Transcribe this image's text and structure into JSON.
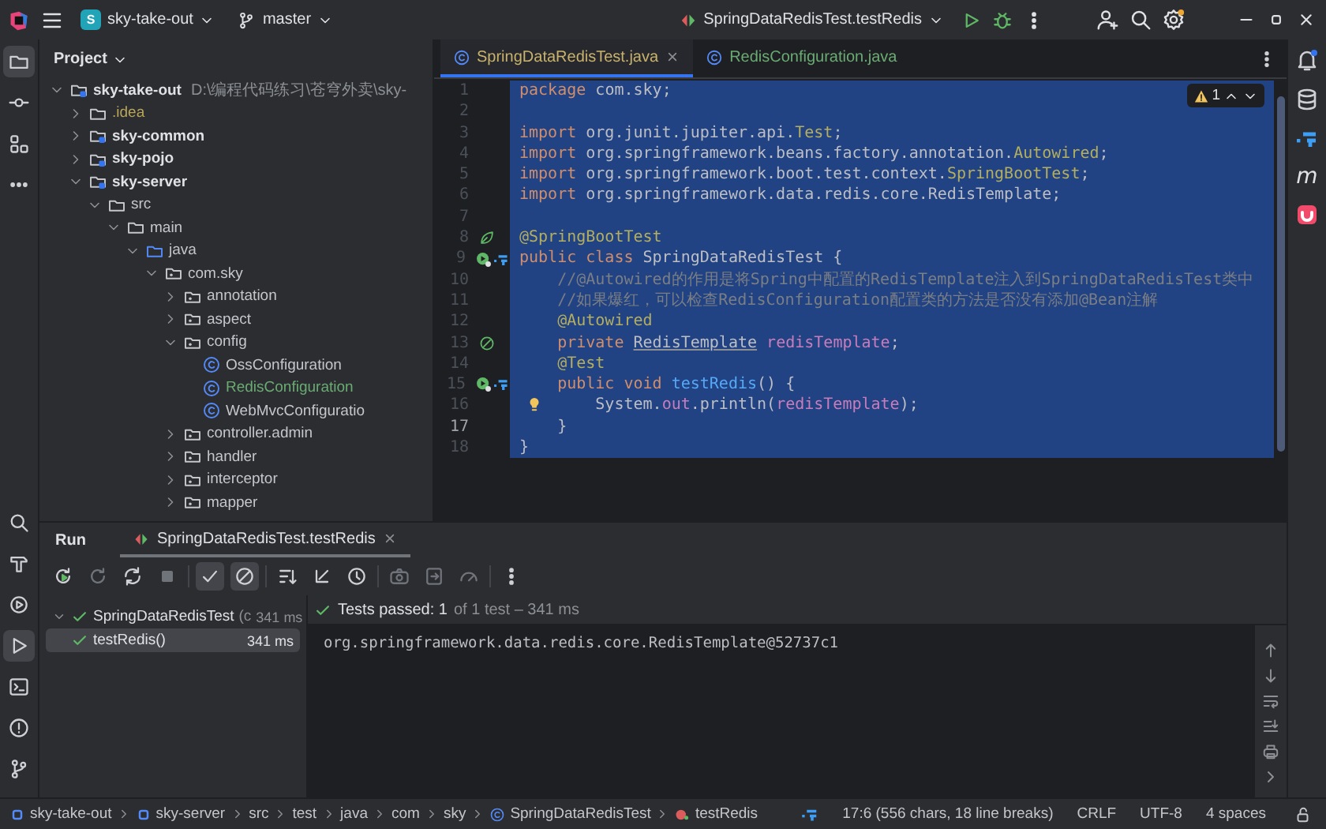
{
  "title_bar": {
    "project": {
      "badge": "S",
      "name": "sky-take-out"
    },
    "branch": "master",
    "run_configuration": "SpringDataRedisTest.testRedis"
  },
  "left_toolbar": {
    "top": [
      {
        "kind": "project",
        "selected": true
      },
      {
        "kind": "commit",
        "selected": false
      },
      {
        "kind": "structure",
        "selected": false
      },
      {
        "kind": "more",
        "selected": false
      }
    ],
    "bottom": [
      {
        "kind": "search",
        "selected": false
      },
      {
        "kind": "build",
        "selected": false
      },
      {
        "kind": "services",
        "selected": false
      },
      {
        "kind": "run",
        "selected": true
      },
      {
        "kind": "terminal",
        "selected": false
      },
      {
        "kind": "problems",
        "selected": false
      },
      {
        "kind": "git",
        "selected": false
      }
    ]
  },
  "right_toolbar": [
    {
      "kind": "notifications"
    },
    {
      "kind": "database"
    },
    {
      "kind": "plugin"
    },
    {
      "kind": "maven",
      "glyph": "m"
    },
    {
      "kind": "app"
    }
  ],
  "project_panel": {
    "title": "Project",
    "tree": [
      {
        "name": "sky-take-out",
        "kind": "module",
        "hint": "D:\\编程代码练习\\苍穹外卖\\sky-",
        "expanded": true,
        "children": [
          {
            "name": ".idea",
            "kind": "folder",
            "color": "#b8a75a",
            "expanded": false
          },
          {
            "name": "sky-common",
            "kind": "module",
            "expanded": false
          },
          {
            "name": "sky-pojo",
            "kind": "module",
            "expanded": false
          },
          {
            "name": "sky-server",
            "kind": "module",
            "expanded": true,
            "children": [
              {
                "name": "src",
                "kind": "folder",
                "expanded": true,
                "children": [
                  {
                    "name": "main",
                    "kind": "folder",
                    "expanded": true,
                    "children": [
                      {
                        "name": "java",
                        "kind": "source",
                        "expanded": true,
                        "children": [
                          {
                            "name": "com.sky",
                            "kind": "package",
                            "expanded": true,
                            "children": [
                              {
                                "name": "annotation",
                                "kind": "package",
                                "expanded": false
                              },
                              {
                                "name": "aspect",
                                "kind": "package",
                                "expanded": false
                              },
                              {
                                "name": "config",
                                "kind": "package",
                                "expanded": true,
                                "children": [
                                  {
                                    "name": "OssConfiguration",
                                    "kind": "class"
                                  },
                                  {
                                    "name": "RedisConfiguration",
                                    "kind": "class",
                                    "color": "#6aab73"
                                  },
                                  {
                                    "name": "WebMvcConfiguratio",
                                    "kind": "class"
                                  }
                                ]
                              },
                              {
                                "name": "controller.admin",
                                "kind": "package",
                                "expanded": false
                              },
                              {
                                "name": "handler",
                                "kind": "package",
                                "expanded": false
                              },
                              {
                                "name": "interceptor",
                                "kind": "package",
                                "expanded": false
                              },
                              {
                                "name": "mapper",
                                "kind": "package",
                                "expanded": false
                              }
                            ]
                          }
                        ]
                      }
                    ]
                  }
                ]
              }
            ]
          }
        ]
      }
    ]
  },
  "editor": {
    "tabs": [
      {
        "label": "SpringDataRedisTest.java",
        "selected": true,
        "color": "#c9b26b"
      },
      {
        "label": "RedisConfiguration.java",
        "selected": false,
        "color": "#6aab73"
      }
    ],
    "warnings": "1",
    "lines": [
      {
        "number": "1",
        "selected": true,
        "current": false,
        "tokens": [
          {
            "kind": "keyword",
            "text": "package"
          },
          {
            "kind": "plain",
            "text": " com.sky;"
          }
        ]
      },
      {
        "number": "2",
        "selected": true,
        "current": false
      },
      {
        "number": "3",
        "selected": true,
        "current": false,
        "tokens": [
          {
            "kind": "keyword",
            "text": "import"
          },
          {
            "kind": "plain",
            "text": " org.junit.jupiter.api."
          },
          {
            "kind": "annotation",
            "text": "Test"
          },
          {
            "kind": "plain",
            "text": ";"
          }
        ]
      },
      {
        "number": "4",
        "selected": true,
        "current": false,
        "tokens": [
          {
            "kind": "keyword",
            "text": "import"
          },
          {
            "kind": "plain",
            "text": " org.springframework.beans.factory.annotation."
          },
          {
            "kind": "annotation",
            "text": "Autowired"
          },
          {
            "kind": "plain",
            "text": ";"
          }
        ]
      },
      {
        "number": "5",
        "selected": true,
        "current": false,
        "tokens": [
          {
            "kind": "keyword",
            "text": "import"
          },
          {
            "kind": "plain",
            "text": " org.springframework.boot.test.context."
          },
          {
            "kind": "annotation",
            "text": "SpringBootTest"
          },
          {
            "kind": "plain",
            "text": ";"
          }
        ]
      },
      {
        "number": "6",
        "selected": true,
        "current": false,
        "tokens": [
          {
            "kind": "keyword",
            "text": "import"
          },
          {
            "kind": "plain",
            "text": " org.springframework.data.redis.core.RedisTemplate;"
          }
        ]
      },
      {
        "number": "7",
        "selected": true,
        "current": false
      },
      {
        "number": "8",
        "selected": true,
        "current": false,
        "markers": [
          {
            "kind": "bean"
          }
        ],
        "tokens": [
          {
            "kind": "annotation",
            "text": "@SpringBootTest"
          }
        ]
      },
      {
        "number": "9",
        "selected": true,
        "current": false,
        "markers": [
          {
            "kind": "run"
          },
          {
            "kind": "plugin"
          }
        ],
        "tokens": [
          {
            "kind": "keyword",
            "text": "public class"
          },
          {
            "kind": "plain",
            "text": " SpringDataRedisTest {"
          }
        ]
      },
      {
        "number": "10",
        "selected": true,
        "current": false,
        "tokens": [
          {
            "kind": "comment",
            "text": "    //@Autowired的作用是将Spring中配置的RedisTemplate注入到SpringDataRedisTest类中"
          }
        ]
      },
      {
        "number": "11",
        "selected": true,
        "current": false,
        "tokens": [
          {
            "kind": "comment",
            "text": "    //如果爆红，可以检查RedisConfiguration配置类的方法是否没有添加@Bean注解"
          }
        ]
      },
      {
        "number": "12",
        "selected": true,
        "current": false,
        "tokens": [
          {
            "kind": "annotation",
            "text": "    @Autowired"
          }
        ]
      },
      {
        "number": "13",
        "selected": true,
        "current": false,
        "markers": [
          {
            "kind": "injected"
          }
        ],
        "tokens": [
          {
            "kind": "keyword",
            "text": "    private "
          },
          {
            "kind": "type",
            "text": "RedisTemplate"
          },
          {
            "kind": "field",
            "text": " redisTemplate"
          },
          {
            "kind": "plain",
            "text": ";"
          }
        ]
      },
      {
        "number": "14",
        "selected": true,
        "current": false,
        "tokens": [
          {
            "kind": "annotation",
            "text": "    @Test"
          }
        ]
      },
      {
        "number": "15",
        "selected": true,
        "current": false,
        "markers": [
          {
            "kind": "run"
          },
          {
            "kind": "plugin"
          }
        ],
        "tokens": [
          {
            "kind": "keyword",
            "text": "    public void "
          },
          {
            "kind": "method",
            "text": "testRedis"
          },
          {
            "kind": "plain",
            "text": "() {"
          }
        ]
      },
      {
        "number": "16",
        "selected": true,
        "current": false,
        "markers": [
          {
            "kind": "bulb"
          }
        ],
        "tokens": [
          {
            "kind": "plain",
            "text": "        System."
          },
          {
            "kind": "field",
            "text": "out"
          },
          {
            "kind": "plain",
            "text": ".println("
          },
          {
            "kind": "field",
            "text": "redisTemplate"
          },
          {
            "kind": "plain",
            "text": ");"
          }
        ]
      },
      {
        "number": "17",
        "selected": true,
        "current": true,
        "tokens": [
          {
            "kind": "plain",
            "text": "    }"
          }
        ]
      },
      {
        "number": "18",
        "selected": true,
        "current": false,
        "tokens": [
          {
            "kind": "plain",
            "text": "}"
          }
        ]
      }
    ]
  },
  "run_panel": {
    "title": "Run",
    "tab": {
      "label": "SpringDataRedisTest.testRedis"
    },
    "toolbar": [
      {
        "kind": "rerun",
        "on": false
      },
      {
        "kind": "rerun-failed",
        "on": false
      },
      {
        "kind": "toggle",
        "on": false
      },
      {
        "kind": "stop",
        "on": false
      },
      {
        "kind": "show-passed",
        "on": true
      },
      {
        "kind": "show-ignored",
        "on": true
      },
      {
        "kind": "sort",
        "on": false
      },
      {
        "kind": "import",
        "on": false
      },
      {
        "kind": "history",
        "on": false
      },
      {
        "kind": "camera",
        "on": false
      },
      {
        "kind": "export",
        "on": false
      },
      {
        "kind": "coverage",
        "on": false
      },
      {
        "kind": "more",
        "on": false
      }
    ],
    "tests": [
      {
        "name": "SpringDataRedisTest",
        "detail": "(c",
        "time": "341 ms",
        "expanded": true,
        "selected": false,
        "children": [
          {
            "name": "testRedis()",
            "time": "341 ms",
            "selected": true
          }
        ]
      }
    ],
    "summary": {
      "status": "Tests passed: 1",
      "detail": "of 1 test – 341 ms"
    },
    "output": [
      "org.springframework.data.redis.core.RedisTemplate@52737c1"
    ],
    "output_toolbar": [
      {
        "kind": "up"
      },
      {
        "kind": "down"
      },
      {
        "kind": "wrap"
      },
      {
        "kind": "scroll-end"
      },
      {
        "kind": "print"
      },
      {
        "kind": "expand"
      }
    ]
  },
  "status_bar": {
    "breadcrumbs": [
      {
        "kind": "module",
        "label": "sky-take-out"
      },
      {
        "kind": "module",
        "label": "sky-server"
      },
      {
        "kind": "folder",
        "label": "src"
      },
      {
        "kind": "folder",
        "label": "test"
      },
      {
        "kind": "folder",
        "label": "java"
      },
      {
        "kind": "folder",
        "label": "com"
      },
      {
        "kind": "folder",
        "label": "sky"
      },
      {
        "kind": "class",
        "label": "SpringDataRedisTest"
      },
      {
        "kind": "method",
        "label": "testRedis"
      }
    ],
    "indicators": [
      {
        "kind": "plugin"
      },
      {
        "kind": "text",
        "label": "17:6 (556 chars, 18 line breaks)"
      },
      {
        "kind": "text",
        "label": "CRLF"
      },
      {
        "kind": "text",
        "label": "UTF-8"
      },
      {
        "kind": "text",
        "label": "4 spaces"
      },
      {
        "kind": "lock"
      }
    ]
  }
}
